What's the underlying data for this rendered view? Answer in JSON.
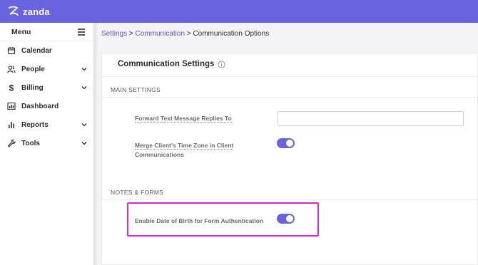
{
  "brand": {
    "name": "zanda",
    "accent": "#6a63e0"
  },
  "sidebar": {
    "title": "Menu",
    "items": [
      {
        "label": "Calendar",
        "icon": "calendar-icon",
        "expandable": false
      },
      {
        "label": "People",
        "icon": "people-icon",
        "expandable": true
      },
      {
        "label": "Billing",
        "icon": "dollar-icon",
        "expandable": true
      },
      {
        "label": "Dashboard",
        "icon": "dashboard-icon",
        "expandable": false
      },
      {
        "label": "Reports",
        "icon": "bar-chart-icon",
        "expandable": true
      },
      {
        "label": "Tools",
        "icon": "wrench-icon",
        "expandable": true
      }
    ]
  },
  "breadcrumb": {
    "links": [
      "Settings",
      "Communication"
    ],
    "separator": ">",
    "current": "Communication Options"
  },
  "page": {
    "title": "Communication Settings",
    "sections": {
      "main": {
        "heading": "MAIN SETTINGS",
        "forward_label": "Forward Text Message Replies To",
        "forward_value": "",
        "forward_placeholder": "",
        "merge_label_line1": "Merge Client's Time Zone in Client",
        "merge_label_line2": "Communications",
        "merge_enabled": true
      },
      "notes": {
        "heading": "NOTES & FORMS",
        "dob_label": "Enable Date of Birth for Form Authentication",
        "dob_enabled": true
      }
    }
  },
  "colors": {
    "toggle_on": "#6a63e0",
    "highlight": "#e51ee0",
    "link": "#5a54cf"
  }
}
